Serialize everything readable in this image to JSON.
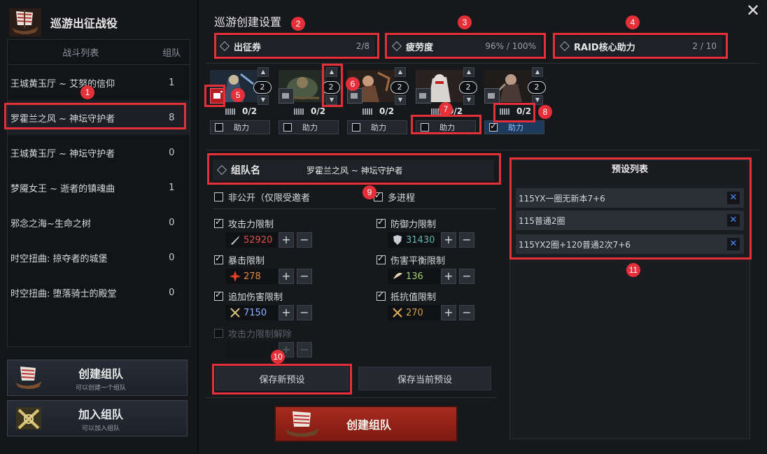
{
  "left": {
    "title": "巡游出征战役",
    "list_headers": {
      "name": "战斗列表",
      "count": "组队"
    },
    "battles": [
      {
        "name": "王城黄玉厅 ~ 艾努的信仰",
        "count": "1"
      },
      {
        "name": "罗霍兰之风 ~ 神坛守护者",
        "count": "8"
      },
      {
        "name": "王城黄玉厅 ~ 神坛守护者",
        "count": "0"
      },
      {
        "name": "梦魇女王 ~ 逝者的镇魂曲",
        "count": "1"
      },
      {
        "name": "邪念之海~生命之树",
        "count": "0"
      },
      {
        "name": "时空扭曲: 掠夺者的城堡",
        "count": "0"
      },
      {
        "name": "时空扭曲: 堕落骑士的殿堂",
        "count": "0"
      }
    ],
    "create_party": {
      "title": "创建组队",
      "sub": "可以创建一个组队"
    },
    "join_party": {
      "title": "加入组队",
      "sub": "可以加入组队"
    }
  },
  "settings": {
    "title": "巡游创建设置",
    "tickets": {
      "label": "出征券",
      "value": "2/8"
    },
    "fatigue": {
      "label": "疲劳度",
      "value": "96% / 100%"
    },
    "raid": {
      "label": "RAID核心助力",
      "value": "2 / 10"
    }
  },
  "slots": [
    {
      "count": "2",
      "tickets": "0/2",
      "assist": "助力",
      "assist_on": false,
      "red": true
    },
    {
      "count": "2",
      "tickets": "0/2",
      "assist": "助力",
      "assist_on": false,
      "red": false
    },
    {
      "count": "2",
      "tickets": "0/2",
      "assist": "助力",
      "assist_on": false,
      "red": false
    },
    {
      "count": "2",
      "tickets": "0/2",
      "assist": "助力",
      "assist_on": false,
      "red": false
    },
    {
      "count": "2",
      "tickets": "0/2",
      "assist": "助力",
      "assist_on": true,
      "red": false
    }
  ],
  "party": {
    "label": "组队名",
    "name": "罗霍兰之风 ~ 神坛守护者",
    "private": "非公开（仅限受邀者",
    "multi": "多进程"
  },
  "limits": {
    "attack": {
      "label": "攻击力限制",
      "value": "52920",
      "color": "#e0504a"
    },
    "defense": {
      "label": "防御力限制",
      "value": "31430",
      "color": "#5fb8b0"
    },
    "crit": {
      "label": "暴击限制",
      "value": "278",
      "color": "#e58a3a"
    },
    "balance": {
      "label": "伤害平衡限制",
      "value": "136",
      "color": "#9fcf6a"
    },
    "extra": {
      "label": "追加伤害限制",
      "value": "7150",
      "color": "#8fb3ff"
    },
    "resist": {
      "label": "抵抗值限制",
      "value": "270",
      "color": "#d4a24a"
    },
    "unlock": {
      "label": "攻击力限制解除"
    }
  },
  "buttons": {
    "save_new": "保存新预设",
    "save_current": "保存当前预设",
    "create": "创建组队"
  },
  "presets": {
    "title": "预设列表",
    "items": [
      "115YX一圈无新本7+6",
      "115普通2圈",
      "115YX2圈+120普通2次7+6"
    ]
  },
  "annotations": [
    "1",
    "2",
    "3",
    "4",
    "5",
    "6",
    "7",
    "8",
    "9",
    "10",
    "11"
  ]
}
